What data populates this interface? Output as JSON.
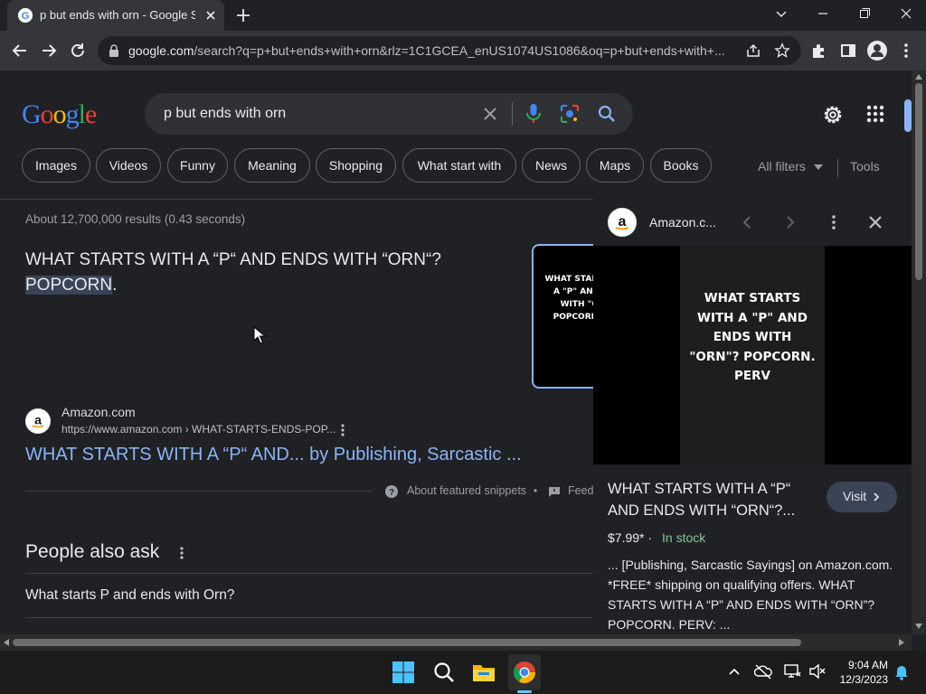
{
  "browser": {
    "tab_title": "p but ends with orn - Google Se",
    "url_host": "google.com",
    "url_path": "/search?q=p+but+ends+with+orn&rlz=1C1GCEA_enUS1074US1086&oq=p+but+ends+with+..."
  },
  "search": {
    "logo": [
      "G",
      "o",
      "o",
      "g",
      "l",
      "e"
    ],
    "query": "p but ends with orn"
  },
  "chips": [
    "Images",
    "Videos",
    "Funny",
    "Meaning",
    "Shopping",
    "What start with",
    "News",
    "Maps",
    "Books"
  ],
  "filters": {
    "all_filters": "All filters",
    "tools": "Tools"
  },
  "results": {
    "stats": "About 12,700,000 results (0.43 seconds)",
    "snippet_question": "WHAT STARTS WITH A “P“ AND ENDS WITH “ORN“?",
    "snippet_answer": "POPCORN",
    "snippet_answer_end": ".",
    "thumb_text": "WHAT STARTS WITH A \"P\" AND ENDS WITH \"ORN\"? POPCORN. PERV",
    "site_letter": "a",
    "site_name": "Amazon.com",
    "site_url": "https://www.amazon.com › WHAT-STARTS-ENDS-POP...",
    "title": "WHAT STARTS WITH A “P“ AND... by Publishing, Sarcastic ...",
    "about_snippets": "About featured snippets",
    "dot": "•",
    "feedback": "Feedback"
  },
  "people_also_ask": {
    "title": "People also ask",
    "questions": [
      "What starts P and ends with Orn?"
    ]
  },
  "side_panel": {
    "avatar_letter": "a",
    "source": "Amazon.c...",
    "image_text": "WHAT STARTS WITH A \"P\" AND ENDS WITH \"ORN\"? POPCORN. PERV",
    "title": "WHAT STARTS WITH A “P“ AND ENDS WITH “ORN“?...",
    "visit": "Visit",
    "price": "$7.99* ·",
    "stock": "In stock",
    "description": "... [Publishing, Sarcastic Sayings] on Amazon.com. *FREE* shipping on qualifying offers. WHAT STARTS WITH A “P” AND ENDS WITH “ORN”? POPCORN. PERV: ..."
  },
  "taskbar": {
    "time": "9:04 AM",
    "date": "12/3/2023"
  },
  "colors": {
    "background": "#202124",
    "link": "#8ab4f8",
    "in_stock": "#81c995",
    "logo": [
      "#4285f4",
      "#ea4335",
      "#fbbc05",
      "#4285f4",
      "#34a853",
      "#ea4335"
    ]
  },
  "icons": [
    "chrome-tab-favicon",
    "close-icon",
    "plus-icon",
    "chevron-down-icon",
    "minimize-icon",
    "restore-icon",
    "back-arrow-icon",
    "forward-arrow-icon",
    "reload-icon",
    "lock-icon",
    "share-icon",
    "star-icon",
    "puzzle-icon",
    "sidepanel-icon",
    "profile-icon",
    "kebab-menu-icon",
    "microphone-icon",
    "lens-camera-icon",
    "search-icon",
    "gear-icon",
    "apps-grid-icon",
    "info-icon",
    "feedback-icon",
    "windows-start-icon",
    "file-explorer-icon",
    "chrome-icon",
    "wifi-off-icon",
    "volume-muted-icon",
    "bell-icon"
  ]
}
